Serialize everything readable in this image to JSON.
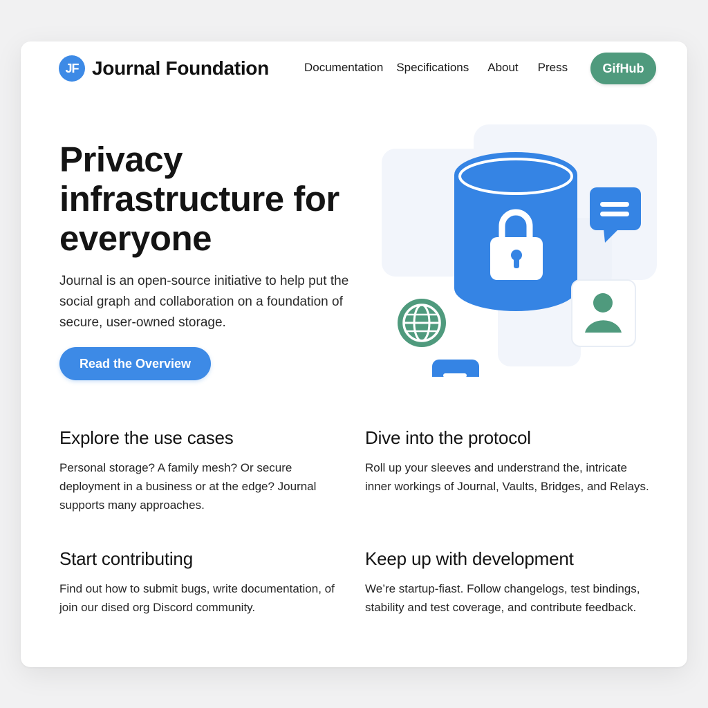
{
  "header": {
    "logo_mark": "JF",
    "logo_text": "Journal Foundation",
    "nav": [
      "Documentation",
      "Specifications",
      "About",
      "Press"
    ],
    "github_label": "GifHub"
  },
  "hero": {
    "title": "Privacy infrastructure for everyone",
    "description": "Journal is an open-source initiative to help put the social graph and collaboration on a foundation of secure, user-owned storage.",
    "cta_label": "Read the Overview"
  },
  "illustration": {
    "icons": [
      "database-icon",
      "lock-icon",
      "chat-bubble-icon",
      "globe-icon",
      "user-icon",
      "message-icon"
    ],
    "colors": {
      "primary": "#3d8ae6",
      "secondary": "#4f9a7d",
      "panel": "#f2f5fb"
    }
  },
  "features": [
    {
      "title": "Explore the use cases",
      "text": "Personal storage? A family mesh? Or secure deployment in a business or at the edge? Journal supports many approaches."
    },
    {
      "title": "Dive into the protocol",
      "text": "Roll up your sleeves and understrand the, intricate inner workings of Journal, Vaults, Bridges, and Relays."
    },
    {
      "title": "Start contributing",
      "text": "Find out how to submit bugs, write documentation, of join our dised org Discord community."
    },
    {
      "title": "Keep up with development",
      "text": "We’re startup-fiast. Follow changelogs, test bindings, stability and test coverage, and contribute feedback."
    }
  ],
  "colors": {
    "accent_blue": "#3d8ae6",
    "accent_green": "#4f9a7d",
    "background": "#f1f1f2",
    "card": "#ffffff"
  }
}
